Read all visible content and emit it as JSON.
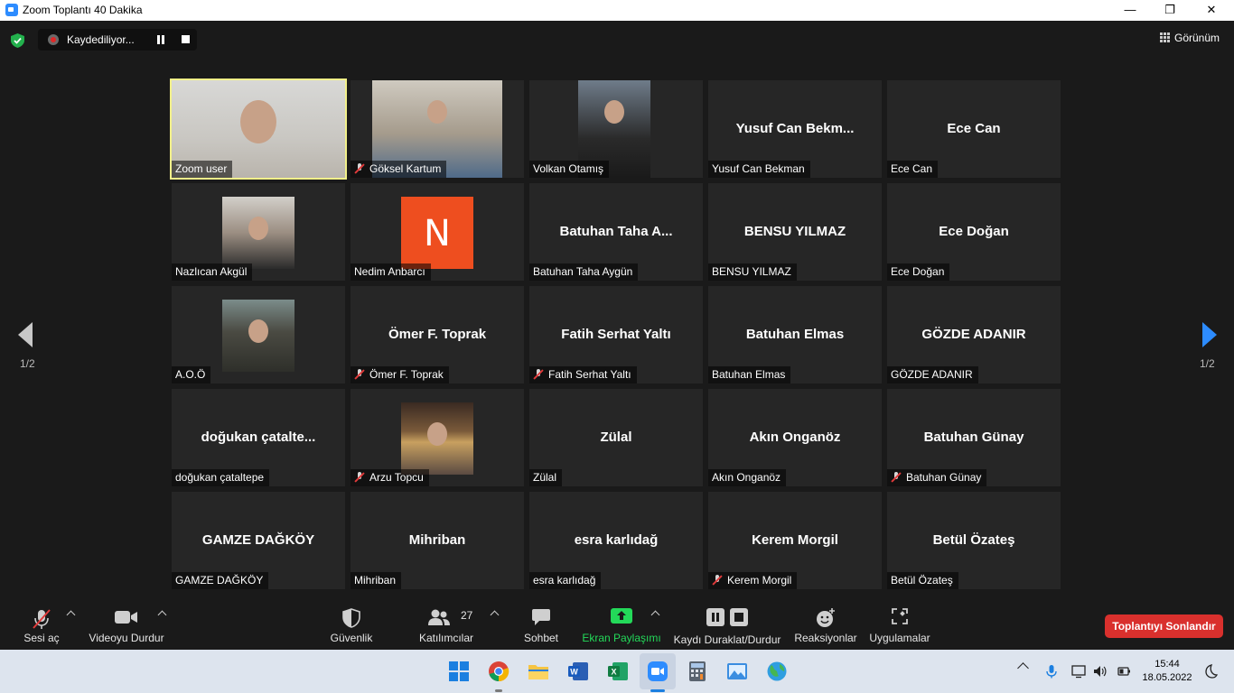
{
  "window": {
    "title": "Zoom Toplantı 40 Dakika",
    "minimize": "—",
    "maximize": "❐",
    "close": "✕"
  },
  "recording": {
    "status": "Kaydediliyor..."
  },
  "view_button": {
    "label": "Görünüm"
  },
  "pagination": {
    "left": "1/2",
    "right": "1/2"
  },
  "participants": [
    {
      "label": "Zoom user",
      "display": "",
      "muted": false,
      "video": "zoomuser",
      "active": true
    },
    {
      "label": "Göksel Kartum",
      "display": "",
      "muted": true,
      "video": "goksel"
    },
    {
      "label": "Volkan Otamış",
      "display": "",
      "muted": false,
      "video": "volkan"
    },
    {
      "label": "Yusuf Can Bekman",
      "display": "Yusuf  Can  Bekm...",
      "muted": false
    },
    {
      "label": "Ece Can",
      "display": "Ece Can",
      "muted": false
    },
    {
      "label": "Nazlıcan Akgül",
      "display": "",
      "muted": false,
      "video": "nazlican"
    },
    {
      "label": "Nedim Anbarcı",
      "display": "",
      "muted": false,
      "video": "nedim",
      "initial": "N"
    },
    {
      "label": "Batuhan Taha Aygün",
      "display": "Batuhan Taha A...",
      "muted": false
    },
    {
      "label": "BENSU YILMAZ",
      "display": "BENSU YILMAZ",
      "muted": false
    },
    {
      "label": "Ece Doğan",
      "display": "Ece Doğan",
      "muted": false
    },
    {
      "label": "A.O.Ö",
      "display": "",
      "muted": false,
      "video": "aoo"
    },
    {
      "label": "Ömer F. Toprak",
      "display": "Ömer F. Toprak",
      "muted": true
    },
    {
      "label": "Fatih Serhat Yaltı",
      "display": "Fatih Serhat Yaltı",
      "muted": true
    },
    {
      "label": "Batuhan Elmas",
      "display": "Batuhan Elmas",
      "muted": false
    },
    {
      "label": "GÖZDE ADANIR",
      "display": "GÖZDE ADANIR",
      "muted": false
    },
    {
      "label": "doğukan çataltepe",
      "display": "doğukan  çatalte...",
      "muted": false
    },
    {
      "label": "Arzu Topcu",
      "display": "",
      "muted": true,
      "video": "arzu"
    },
    {
      "label": "Zülal",
      "display": "Zülal",
      "muted": false
    },
    {
      "label": "Akın Onganöz",
      "display": "Akın Onganöz",
      "muted": false
    },
    {
      "label": "Batuhan Günay",
      "display": "Batuhan Günay",
      "muted": true
    },
    {
      "label": "GAMZE DAĞKÖY",
      "display": "GAMZE DAĞKÖY",
      "muted": false
    },
    {
      "label": "Mihriban",
      "display": "Mihriban",
      "muted": false
    },
    {
      "label": "esra karlıdağ",
      "display": "esra karlıdağ",
      "muted": false
    },
    {
      "label": "Kerem Morgil",
      "display": "Kerem Morgil",
      "muted": true
    },
    {
      "label": "Betül Özateş",
      "display": "Betül Özateş",
      "muted": false
    }
  ],
  "toolbar": {
    "unmute": "Sesi aç",
    "stop_video": "Videoyu Durdur",
    "security": "Güvenlik",
    "participants": "Katılımcılar",
    "participants_count": "27",
    "chat": "Sohbet",
    "share_screen": "Ekran Paylaşımı",
    "recording": "Kaydı Duraklat/Durdur",
    "reactions": "Reaksiyonlar",
    "apps": "Uygulamalar",
    "end_meeting": "Toplantıyı Sonlandır"
  },
  "taskbar": {
    "time": "15:44",
    "date": "18.05.2022"
  },
  "colors": {
    "accent": "#2D8CFF",
    "active_speaker": "#f2f08a",
    "share_green": "#23d959",
    "end_red": "#d9302d",
    "background": "#1a1a1a",
    "tile": "#262626"
  }
}
